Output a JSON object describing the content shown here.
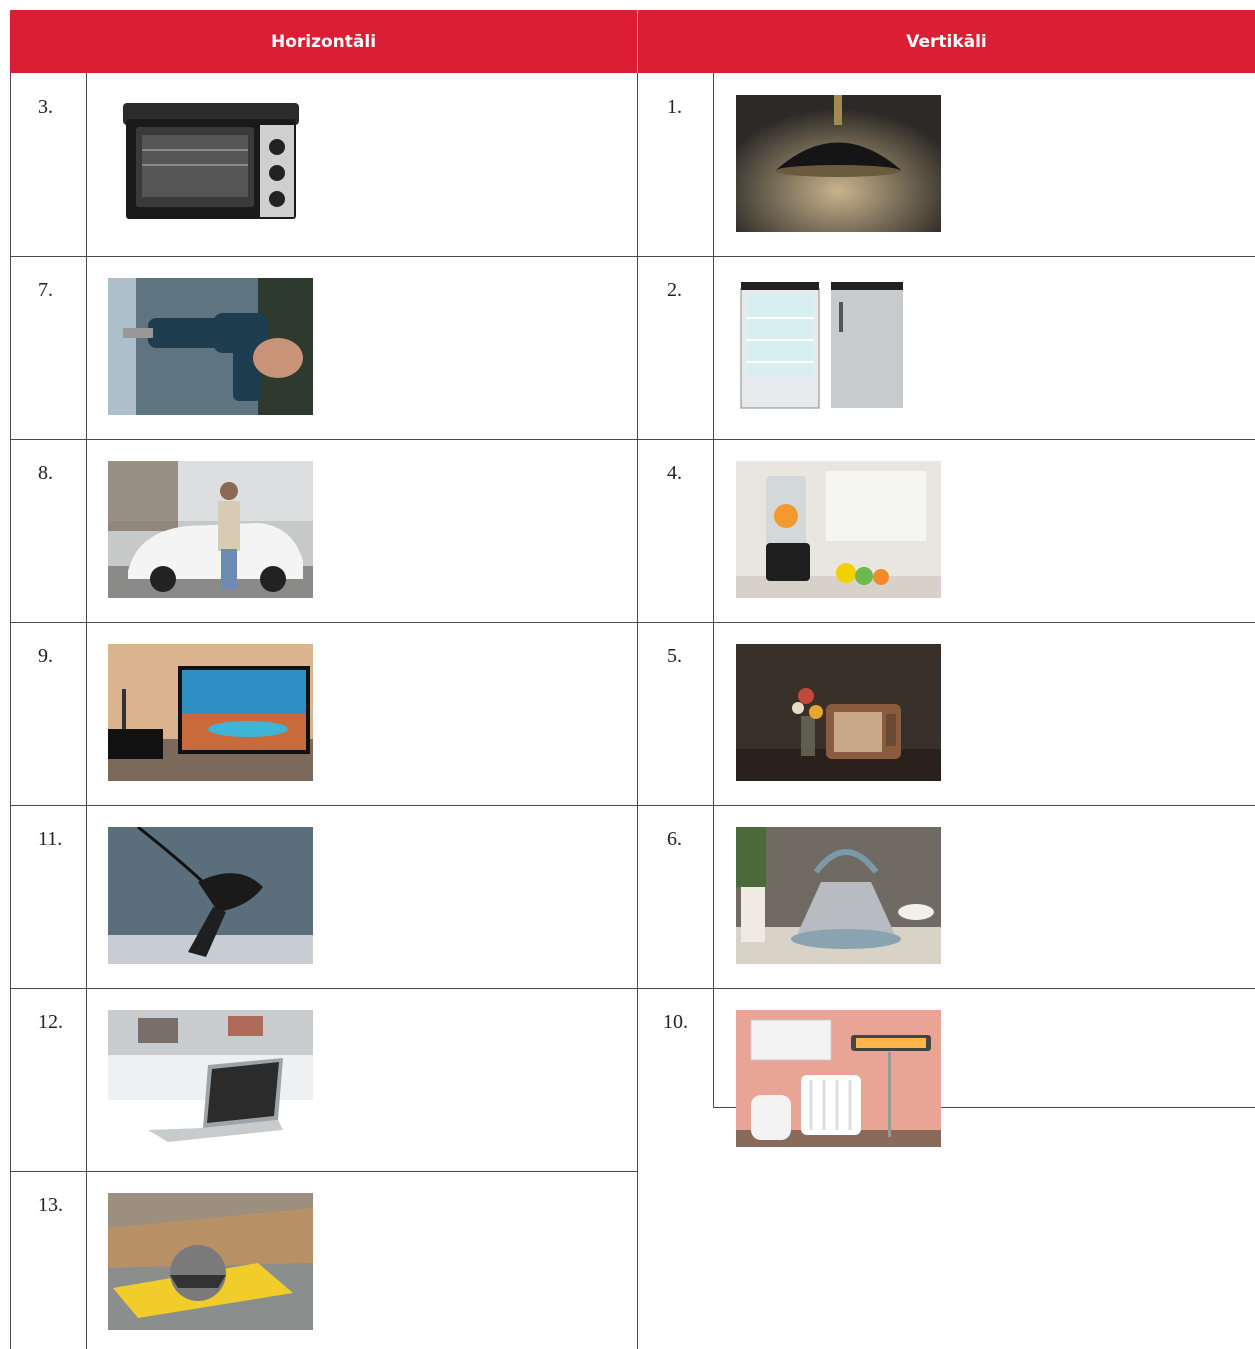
{
  "headers": {
    "left": "Horizontāli",
    "right": "Vertikāli"
  },
  "left_items": [
    {
      "number": "3.",
      "image": "toaster-oven"
    },
    {
      "number": "7.",
      "image": "power-drill"
    },
    {
      "number": "8.",
      "image": "electric-car-charging"
    },
    {
      "number": "9.",
      "image": "flat-screen-tv"
    },
    {
      "number": "11.",
      "image": "hair-dryer"
    },
    {
      "number": "12.",
      "image": "laptop"
    },
    {
      "number": "13.",
      "image": "table-saw"
    }
  ],
  "right_items": [
    {
      "number": "1.",
      "image": "pendant-lamp"
    },
    {
      "number": "2.",
      "image": "refrigerator"
    },
    {
      "number": "4.",
      "image": "blender"
    },
    {
      "number": "5.",
      "image": "retro-radio"
    },
    {
      "number": "6.",
      "image": "electric-kettle"
    },
    {
      "number": "10.",
      "image": "space-heaters"
    }
  ],
  "colors": {
    "header_bg": "#dc1e35",
    "header_text": "#ffffff",
    "grid_line": "#4a4a4a"
  }
}
